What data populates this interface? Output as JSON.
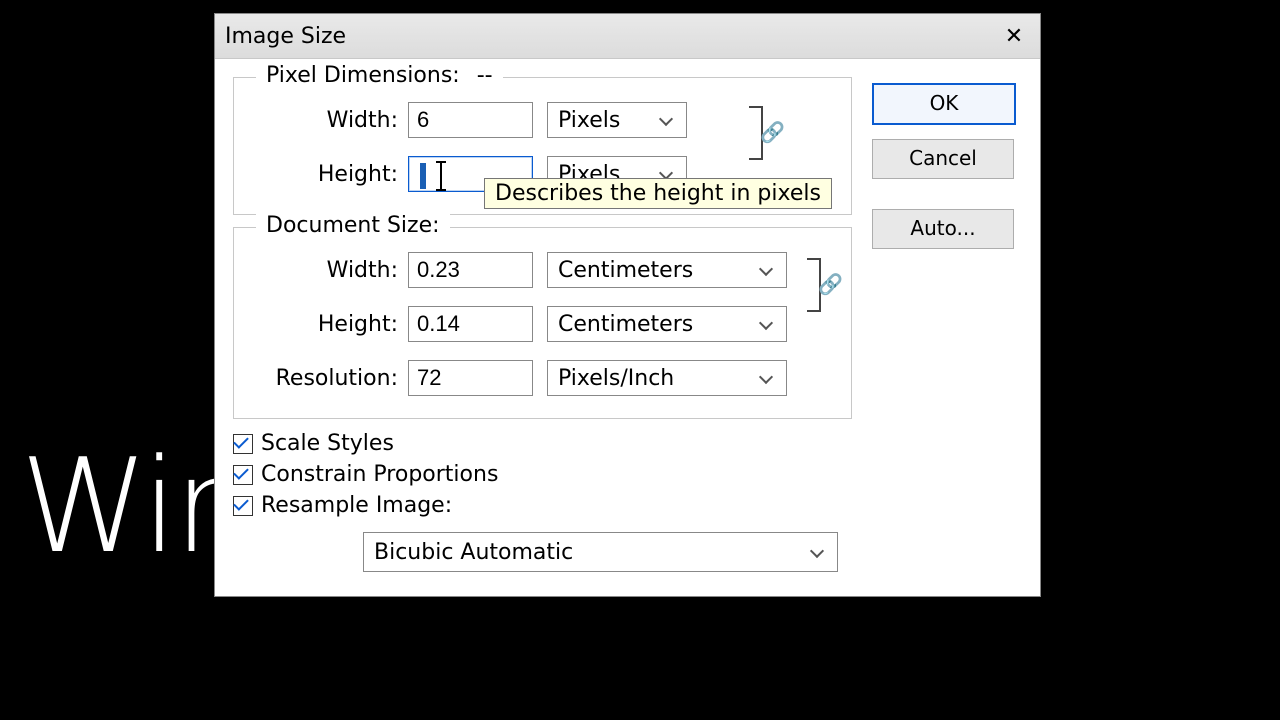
{
  "bg_text": "Wir",
  "title": "Image Size",
  "buttons": {
    "ok": "OK",
    "cancel": "Cancel",
    "auto": "Auto..."
  },
  "pixel_dimensions": {
    "legend": "Pixel Dimensions:",
    "extra": "--",
    "width_label": "Width:",
    "width_value": "6",
    "width_unit": "Pixels",
    "height_label": "Height:",
    "height_value": "",
    "height_unit": "Pixels",
    "link_icon": "🔗"
  },
  "tooltip": "Describes the height in pixels",
  "document_size": {
    "legend": "Document Size:",
    "width_label": "Width:",
    "width_value": "0.23",
    "width_unit": "Centimeters",
    "height_label": "Height:",
    "height_value": "0.14",
    "height_unit": "Centimeters",
    "resolution_label": "Resolution:",
    "resolution_value": "72",
    "resolution_unit": "Pixels/Inch",
    "link_icon": "🔗"
  },
  "checks": {
    "scale_styles": "Scale Styles",
    "constrain": "Constrain Proportions",
    "resample": "Resample Image:"
  },
  "resample_method": "Bicubic Automatic"
}
